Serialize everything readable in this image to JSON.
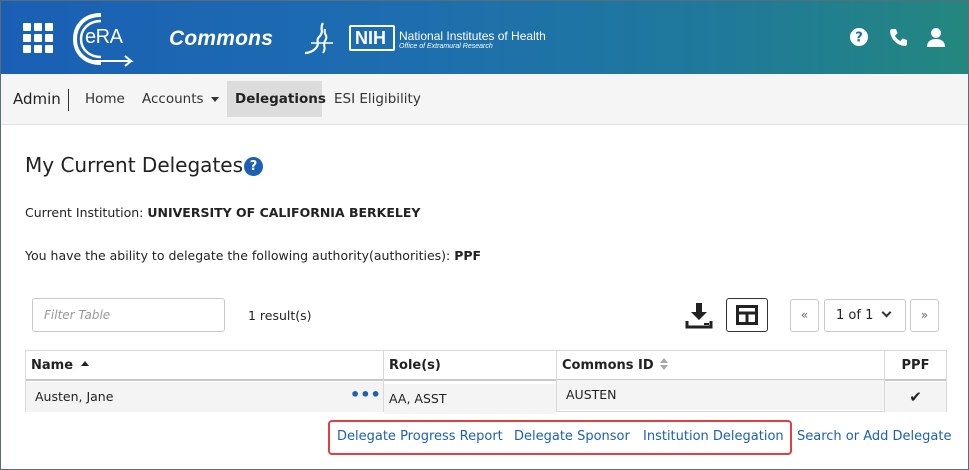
{
  "header": {
    "logo_text": "eRA",
    "app_title": "Commons",
    "nih_abbrev": "NIH",
    "nih_name": "National Institutes of Health",
    "nih_office": "Office of Extramural Research",
    "icons": [
      "apps-grid-icon",
      "help-icon",
      "phone-icon",
      "user-icon"
    ]
  },
  "nav": {
    "section": "Admin",
    "items": [
      {
        "label": "Home"
      },
      {
        "label": "Accounts"
      },
      {
        "label": "Delegations"
      },
      {
        "label": "ESI Eligibility"
      }
    ]
  },
  "page": {
    "title": "My Current Delegates",
    "help_glyph": "?",
    "institution_label": "Current Institution: ",
    "institution_value": "UNIVERSITY OF CALIFORNIA BERKELEY",
    "authority_label": "You have the ability to delegate the following authority(authorities): ",
    "authority_value": "PPF"
  },
  "table_controls": {
    "filter_placeholder": "Filter Table",
    "filter_value": "",
    "result_count": "1 result(s)",
    "pager": {
      "first": "«",
      "page_display": "1 of 1",
      "last": "»"
    }
  },
  "table": {
    "columns": [
      {
        "label": "Name",
        "sort": "ascending"
      },
      {
        "label": "Role(s)"
      },
      {
        "label": "Commons ID",
        "sort": "sortable"
      },
      {
        "label": "PPF"
      }
    ],
    "rows": [
      {
        "name": "Austen, Jane",
        "menu": "•••",
        "roles": "AA, ASST",
        "commons_id": "AUSTEN",
        "ppf": "✔"
      }
    ]
  },
  "actions": {
    "highlighted": [
      "Delegate Progress Report",
      "Delegate Sponsor",
      "Institution Delegation"
    ],
    "search_add": "Search or Add Delegate"
  },
  "colors": {
    "header_start": "#1a5fb4",
    "header_end": "#23877e",
    "link": "#1d5fb3",
    "highlight_border": "#e04040"
  }
}
